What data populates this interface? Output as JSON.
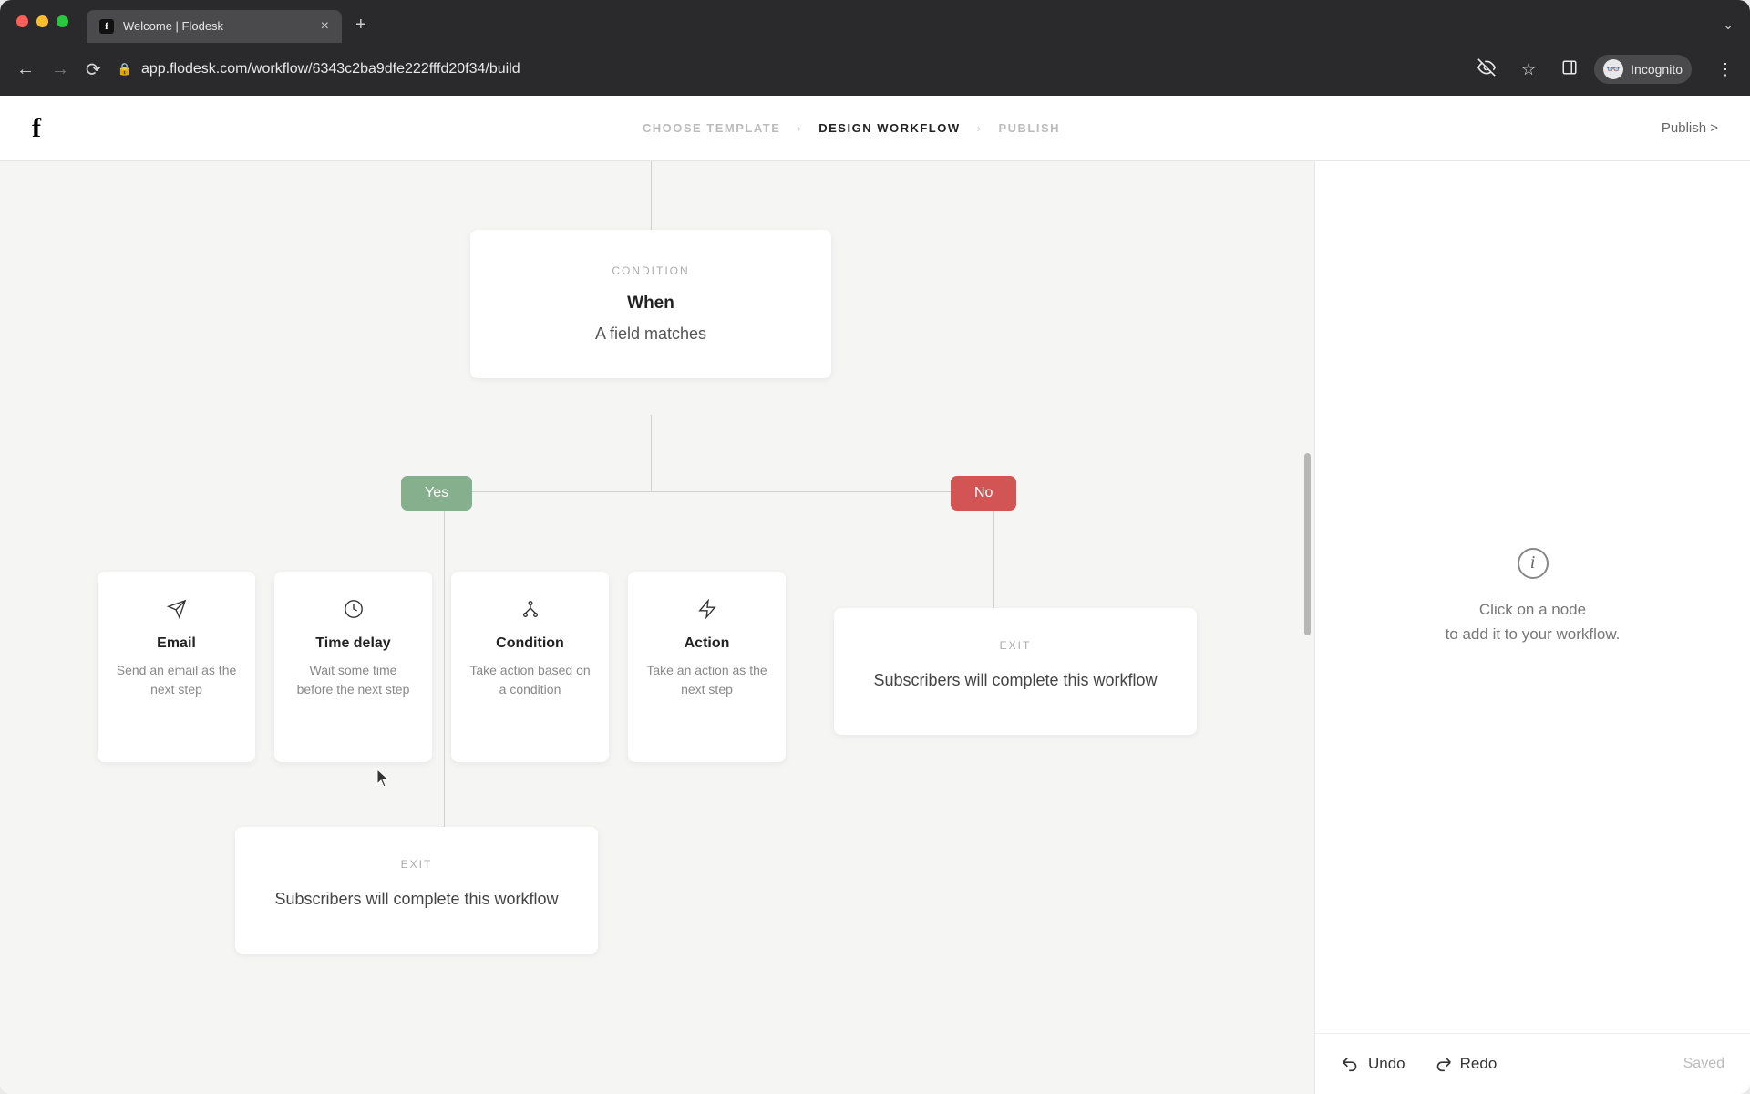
{
  "browser": {
    "tab_title": "Welcome | Flodesk",
    "url": "app.flodesk.com/workflow/6343c2ba9dfe222fffd20f34/build",
    "incognito_label": "Incognito"
  },
  "header": {
    "breadcrumb": {
      "choose": "CHOOSE TEMPLATE",
      "design": "DESIGN WORKFLOW",
      "publish": "PUBLISH"
    },
    "publish_link": "Publish >"
  },
  "workflow": {
    "condition": {
      "label": "CONDITION",
      "title": "When",
      "desc": "A field matches"
    },
    "branches": {
      "yes": "Yes",
      "no": "No"
    },
    "steps": [
      {
        "title": "Email",
        "desc": "Send an email as the next step"
      },
      {
        "title": "Time delay",
        "desc": "Wait some time before the next step"
      },
      {
        "title": "Condition",
        "desc": "Take action based on a condition"
      },
      {
        "title": "Action",
        "desc": "Take an action as the next step"
      }
    ],
    "exit": {
      "label": "EXIT",
      "text": "Subscribers will complete this workflow"
    }
  },
  "sidebar": {
    "hint_line1": "Click on a node",
    "hint_line2": "to add it to your workflow.",
    "undo": "Undo",
    "redo": "Redo",
    "saved": "Saved"
  }
}
